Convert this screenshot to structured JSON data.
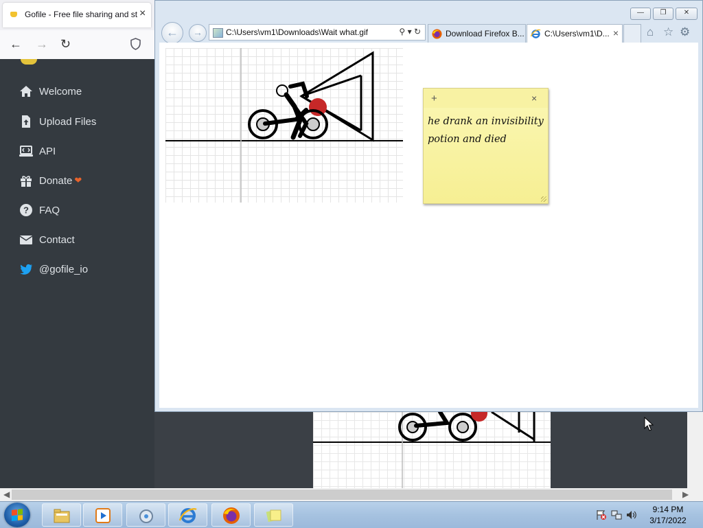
{
  "firefox": {
    "tab_title": "Gofile - Free file sharing and storage",
    "tab_close": "×"
  },
  "gofile": {
    "sidebar": [
      {
        "label": "Welcome",
        "icon": "home-icon"
      },
      {
        "label": "Upload Files",
        "icon": "file-upload-icon"
      },
      {
        "label": "API",
        "icon": "laptop-code-icon"
      },
      {
        "label": "Donate",
        "icon": "gift-icon"
      },
      {
        "label": "FAQ",
        "icon": "question-circle-icon"
      },
      {
        "label": "Contact",
        "icon": "envelope-icon"
      },
      {
        "label": "@gofile_io",
        "icon": "twitter-icon"
      }
    ],
    "donate_heart": "❤"
  },
  "ie": {
    "address": "C:\\Users\\vm1\\Downloads\\Wait what.gif",
    "tabs": [
      {
        "label": "Download Firefox B...",
        "icon": "firefox-icon",
        "active": false
      },
      {
        "label": "C:\\Users\\vm1\\D...",
        "icon": "ie-icon",
        "active": true
      }
    ],
    "tab_close": "×",
    "controls": {
      "minimize": "—",
      "restore": "❐",
      "close": "✕"
    }
  },
  "sticky_note": {
    "text": "he drank an invisibility potion and died",
    "add": "+",
    "close": "×"
  },
  "taskbar": {
    "time": "9:14 PM",
    "date": "3/17/2022",
    "pinned": [
      "file-explorer-icon",
      "media-player-icon",
      "control-panel-icon",
      "internet-explorer-icon",
      "firefox-icon",
      "sticky-notes-icon"
    ]
  },
  "colors": {
    "sidebar_bg": "#343a40",
    "sticky_bg": "#fbf7b4",
    "taskbar_bg": "#a6c2e0",
    "twitter_blue": "#1da1f2",
    "heart": "#e8632c"
  }
}
